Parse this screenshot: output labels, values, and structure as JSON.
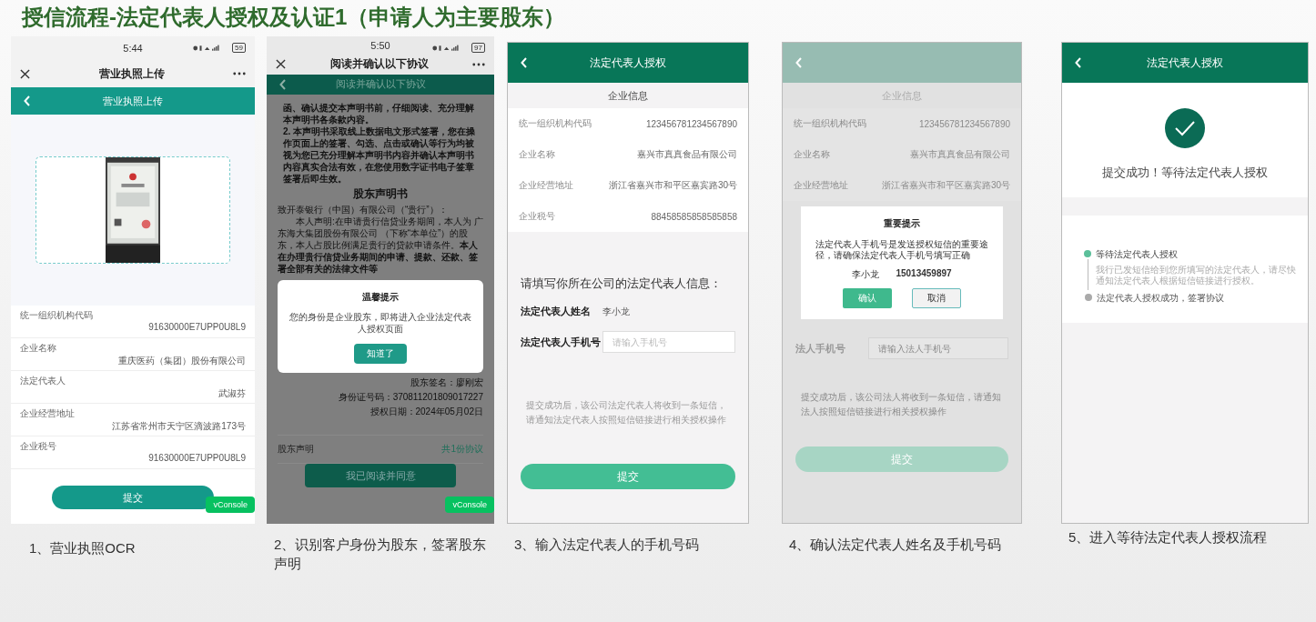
{
  "title": "授信流程-法定代表人授权及认证1（申请人为主要股东）",
  "steps": [
    {
      "kind": "license_upload",
      "caption": "1、营业执照OCR",
      "time": "5:44",
      "battery": "59",
      "window_title": "营业执照上传",
      "header": "营业执照上传",
      "fields": [
        {
          "label": "统一组织机构代码",
          "value": "91630000E7UPP0U8L9"
        },
        {
          "label": "企业名称",
          "value": "重庆医药（集团）股份有限公司"
        },
        {
          "label": "法定代表人",
          "value": "武淑芬"
        },
        {
          "label": "企业经营地址",
          "value": "江苏省常州市天宁区滴波路173号"
        },
        {
          "label": "企业税号",
          "value": "91630000E7UPP0U8L9"
        }
      ],
      "button": "提交",
      "console": "vConsole"
    },
    {
      "kind": "agreement",
      "caption": "2、识别客户身份为股东，签署股东声明",
      "time": "5:50",
      "battery": "97",
      "window_title": "阅读并确认以下协议",
      "header": "阅读并确认以下协议",
      "bold_paragraphs": [
        "函、确认提交本声明书前，仔细阅读、充分理解本声明书各条款内容。",
        "2. 本声明书采取线上数据电文形式签署，您在操作页面上的签署、勾选、点击或确认等行为均被视为您已充分理解本声明书内容并确认本声明书内容真实合法有效，在您使用数字证书电子签章签署后即生效。"
      ],
      "doc_title": "股东声明书",
      "addressee": "致开泰银行（中国）有限公司（“贵行”）：",
      "body": "本人声明:在申请贵行信贷业务期间，本人为 广东海大集团股份有限公司 （下称“本单位”）的股东，本人占股比例满足贵行的贷款申请条件。**本人在办理贵行信贷业务期间的申请、提款、还款、签署全部有关的法律文件等**",
      "dialog": {
        "title": "温馨提示",
        "message": "您的身份是企业股东，即将进入企业法定代表人授权页面",
        "button": "知道了"
      },
      "signature_lines": [
        "股东签名：廖刚宏",
        "身份证号码：370811201809017227",
        "授权日期：2024年05月02日"
      ],
      "footer_left": "股东声明",
      "footer_right": "共1份协议",
      "button": "我已阅读并同意",
      "console": "vConsole"
    },
    {
      "kind": "legal_rep_form",
      "caption": "3、输入法定代表人的手机号码",
      "header": "法定代表人授权",
      "section": "企业信息",
      "fields": [
        {
          "label": "统一组织机构代码",
          "value": "123456781234567890"
        },
        {
          "label": "企业名称",
          "value": "嘉兴市真真食品有限公司"
        },
        {
          "label": "企业经营地址",
          "value": "浙江省嘉兴市和平区嘉宾路30号"
        },
        {
          "label": "企业税号",
          "value": "88458585858585858"
        }
      ],
      "form_title": "请填写你所在公司的法定代表人信息：",
      "name_label": "法定代表人姓名",
      "name_value": "李小龙",
      "phone_label": "法定代表人手机号",
      "phone_placeholder": "请输入手机号",
      "hint": "提交成功后，该公司法定代表人将收到一条短信，请通知法定代表人按照短信链接进行相关授权操作",
      "button": "提交"
    },
    {
      "kind": "confirm_dialog",
      "caption": "4、确认法定代表人姓名及手机号码",
      "section": "企业信息",
      "fields": [
        {
          "label": "统一组织机构代码",
          "value": "123456781234567890"
        },
        {
          "label": "企业名称",
          "value": "嘉兴市真真食品有限公司"
        },
        {
          "label": "企业经营地址",
          "value": "浙江省嘉兴市和平区嘉宾路30号"
        }
      ],
      "dialog": {
        "title": "重要提示",
        "message": "法定代表人手机号是发送授权短信的重要途径，请确保法定代表人手机号填写正确",
        "name": "李小龙",
        "phone": "15013459897",
        "confirm": "确认",
        "cancel": "取消"
      },
      "phone_label": "法人手机号",
      "phone_placeholder": "请输入法人手机号",
      "hint": "提交成功后，该公司法人将收到一条短信，请通知法人按照短信链接进行相关授权操作",
      "button": "提交"
    },
    {
      "kind": "success",
      "caption": "5、进入等待法定代表人授权流程",
      "header": "法定代表人授权",
      "message": "提交成功！等待法定代表人授权",
      "timeline": [
        {
          "title": "等待法定代表人授权",
          "detail": "我行已发短信给到您所填写的法定代表人，请尽快通知法定代表人根据短信链接进行授权。",
          "active": true
        },
        {
          "title": "法定代表人授权成功，签署协议",
          "active": false
        }
      ]
    }
  ]
}
